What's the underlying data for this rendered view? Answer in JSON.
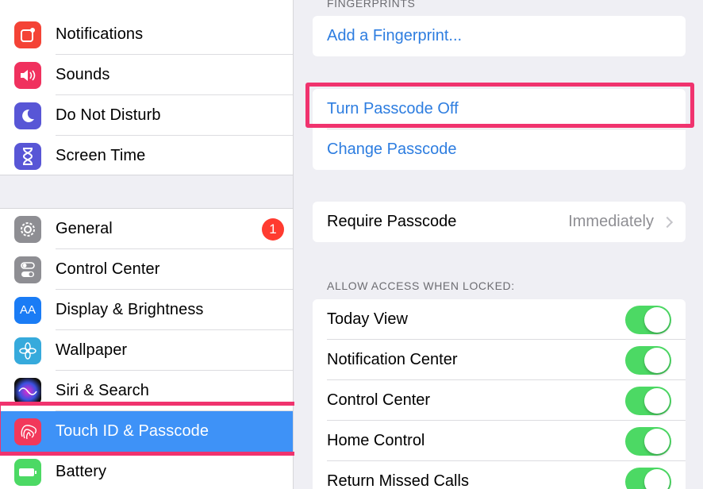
{
  "sidebar": {
    "group1": [
      {
        "label": "Notifications",
        "icon": "notifications-icon",
        "color": "#f44336"
      },
      {
        "label": "Sounds",
        "icon": "sounds-icon",
        "color": "#f0315e"
      },
      {
        "label": "Do Not Disturb",
        "icon": "moon-icon",
        "color": "#5856d6"
      },
      {
        "label": "Screen Time",
        "icon": "hourglass-icon",
        "color": "#5856d6"
      }
    ],
    "group2": [
      {
        "label": "General",
        "icon": "gear-icon",
        "color": "#8e8e93",
        "badge": "1"
      },
      {
        "label": "Control Center",
        "icon": "switches-icon",
        "color": "#8e8e93"
      },
      {
        "label": "Display & Brightness",
        "icon": "display-icon",
        "color": "#1a7cf5",
        "glyph": "AA"
      },
      {
        "label": "Wallpaper",
        "icon": "flower-icon",
        "color": "#36aadc"
      },
      {
        "label": "Siri & Search",
        "icon": "siri-icon",
        "color": "#222"
      },
      {
        "label": "Touch ID & Passcode",
        "icon": "fingerprint-icon",
        "color": "#f2385a",
        "selected": true
      },
      {
        "label": "Battery",
        "icon": "battery-icon",
        "color": "#4cd964"
      }
    ]
  },
  "main": {
    "fingerprints_header": "FINGERPRINTS",
    "add_fingerprint": "Add a Fingerprint...",
    "turn_off": "Turn Passcode Off",
    "change": "Change Passcode",
    "require_label": "Require Passcode",
    "require_value": "Immediately",
    "allow_header": "ALLOW ACCESS WHEN LOCKED:",
    "toggles": [
      {
        "label": "Today View",
        "on": true
      },
      {
        "label": "Notification Center",
        "on": true
      },
      {
        "label": "Control Center",
        "on": true
      },
      {
        "label": "Home Control",
        "on": true
      },
      {
        "label": "Return Missed Calls",
        "on": true
      }
    ]
  },
  "colors": {
    "highlight": "#f0336e",
    "accent": "#2d7de0",
    "selected": "#3e92f7",
    "toggle_on": "#4cd964"
  }
}
